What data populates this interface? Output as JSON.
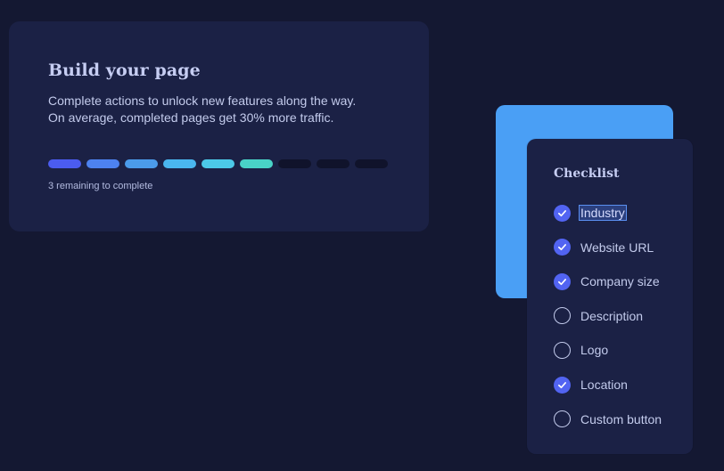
{
  "build": {
    "title": "Build your page",
    "description_lines": [
      "Complete actions to unlock new features along the way.",
      "On average, completed pages get 30% more traffic."
    ],
    "progress_segments": [
      {
        "color": "#4b5cf0",
        "filled": true
      },
      {
        "color": "#4d82f0",
        "filled": true
      },
      {
        "color": "#4b9bea",
        "filled": true
      },
      {
        "color": "#4ab6ee",
        "filled": true
      },
      {
        "color": "#4cc9e8",
        "filled": true
      },
      {
        "color": "#49d3c7",
        "filled": true
      },
      {
        "color": "#10132b",
        "filled": false
      },
      {
        "color": "#10132b",
        "filled": false
      },
      {
        "color": "#10132b",
        "filled": false
      }
    ],
    "remaining_text": "3 remaining to complete"
  },
  "checklist": {
    "title": "Checklist",
    "items": [
      {
        "label": "Industry",
        "checked": true,
        "selected": true
      },
      {
        "label": "Website URL",
        "checked": true,
        "selected": false
      },
      {
        "label": "Company size",
        "checked": true,
        "selected": false
      },
      {
        "label": "Description",
        "checked": false,
        "selected": false
      },
      {
        "label": "Logo",
        "checked": false,
        "selected": false
      },
      {
        "label": "Location",
        "checked": true,
        "selected": false
      },
      {
        "label": "Custom button",
        "checked": false,
        "selected": false
      }
    ]
  },
  "colors": {
    "background": "#141832",
    "card": "#1b2145",
    "accent_card": "#4a9ff5",
    "check_fill": "#5264f2"
  }
}
